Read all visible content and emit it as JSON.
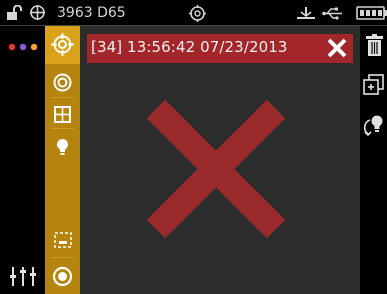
{
  "status_bar": {
    "device_label": "3963 D65",
    "icons": [
      "lock-open-icon",
      "crosshair-plus-icon",
      "measurement-target-icon",
      "tripod-icon",
      "usb-icon",
      "battery-icon"
    ]
  },
  "left_rail": {
    "icons": [
      "menu-dots-icon",
      "sliders-icon"
    ],
    "dot_colors": [
      "#e53935",
      "#8e5bd8",
      "#f2a33a"
    ]
  },
  "tool_rail": {
    "items": [
      "target-crosshair-icon",
      "concentric-circles-icon",
      "grid-icon",
      "lightbulb-icon",
      "dashed-frame-icon",
      "measure-button-icon"
    ],
    "selected_index": 0
  },
  "main": {
    "record_header": "[34] 13:56:42 07/23/2013",
    "header_icon": "close-icon",
    "status_mark": "fail-cross-icon"
  },
  "right_rail": {
    "icons": [
      "trash-icon",
      "copy-icon",
      "lightbulb-rotate-icon"
    ]
  },
  "colors": {
    "tool_rail": "#b5840f",
    "tool_rail_selected": "#d9a218",
    "header_bar": "#a3262a",
    "fail_cross": "#9b2a2c",
    "main_bg": "#2c2c2c"
  }
}
